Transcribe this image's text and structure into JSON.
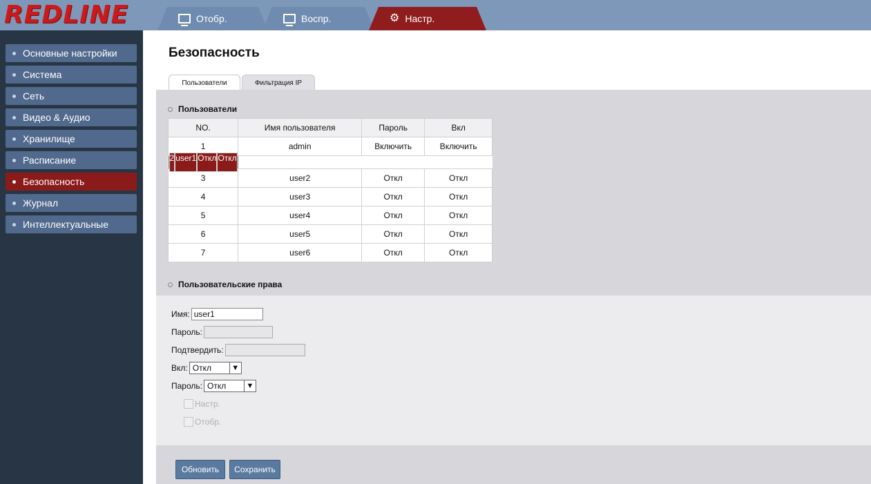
{
  "brand": {
    "logo_text": "REDLINE",
    "color": "#cc1a1a"
  },
  "top_tabs": [
    {
      "label": "Отобр.",
      "icon": "monitor-icon"
    },
    {
      "label": "Воспр.",
      "icon": "monitor-icon"
    },
    {
      "label": "Настр.",
      "icon": "gear-icon",
      "active": true
    }
  ],
  "sidebar": {
    "items": [
      {
        "label": "Основные настройки"
      },
      {
        "label": "Система"
      },
      {
        "label": "Сеть"
      },
      {
        "label": "Видео & Аудио"
      },
      {
        "label": "Хранилище"
      },
      {
        "label": "Расписание"
      },
      {
        "label": "Безопасность",
        "active": true
      },
      {
        "label": "Журнал"
      },
      {
        "label": "Интеллектуальные"
      }
    ]
  },
  "page": {
    "title": "Безопасность",
    "tabs": [
      {
        "label": "Пользователи",
        "active": true
      },
      {
        "label": "Фильтрация IP"
      }
    ]
  },
  "users_section": {
    "title": "Пользователи",
    "columns": [
      "NO.",
      "Имя пользователя",
      "Пароль",
      "Вкл"
    ],
    "rows": [
      [
        "1",
        "admin",
        "Включить",
        "Включить"
      ],
      [
        "2",
        "user1",
        "Откл",
        "Откл"
      ],
      [
        "3",
        "user2",
        "Откл",
        "Откл"
      ],
      [
        "4",
        "user3",
        "Откл",
        "Откл"
      ],
      [
        "5",
        "user4",
        "Откл",
        "Откл"
      ],
      [
        "6",
        "user5",
        "Откл",
        "Откл"
      ],
      [
        "7",
        "user6",
        "Откл",
        "Откл"
      ]
    ],
    "selected_row": 2
  },
  "rights_section": {
    "title": "Пользовательские права",
    "name_label": "Имя:",
    "name_value": "user1",
    "password_label": "Пароль:",
    "confirm_label": "Подтвердить:",
    "enable_label": "Вкл:",
    "enable_value": "Откл",
    "password_mode_label": "Пароль:",
    "password_mode_value": "Откл",
    "perm_settings": "Настр.",
    "perm_view": "Отобр."
  },
  "buttons": {
    "refresh": "Обновить",
    "save": "Сохранить"
  },
  "colors": {
    "accent": "#8b1b1b",
    "topbar": "#7e98b9",
    "sidebar_bg": "#283545",
    "sidebar_item": "#50698c"
  }
}
